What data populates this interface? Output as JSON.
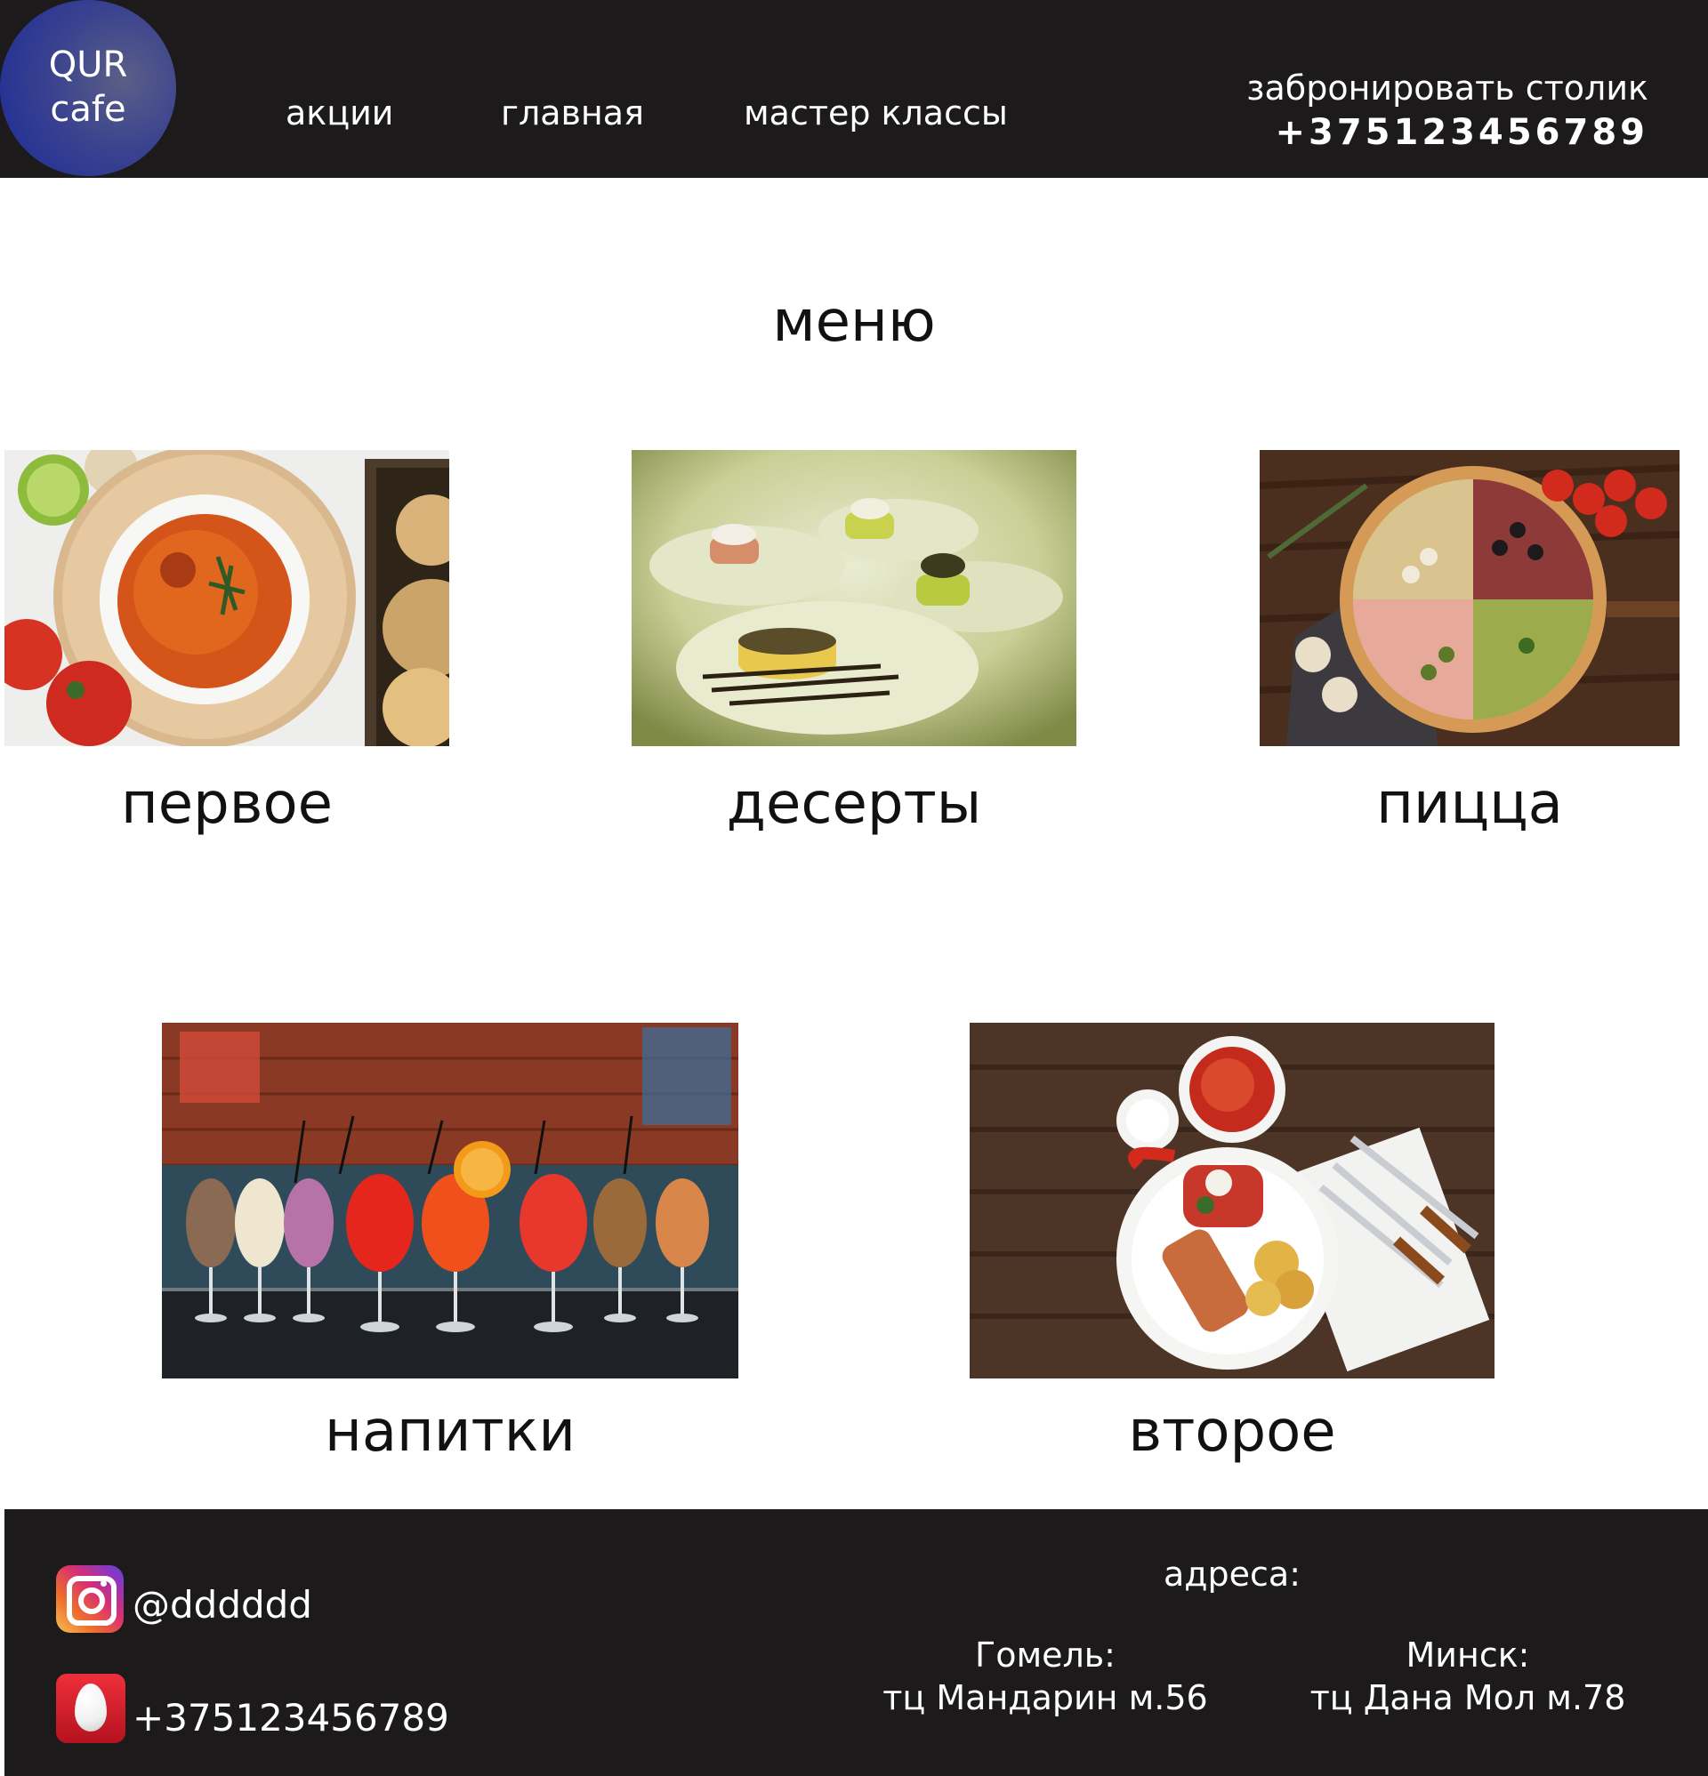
{
  "header": {
    "logo": {
      "line1": "QUR",
      "line2": "cafe"
    },
    "nav": [
      {
        "label": "акции"
      },
      {
        "label": "главная"
      },
      {
        "label": "мастер классы"
      }
    ],
    "booking": {
      "label": "забронировать столик",
      "phone": "+375123456789"
    }
  },
  "menu": {
    "title": "меню",
    "items": [
      {
        "label": "первое"
      },
      {
        "label": "десерты"
      },
      {
        "label": "пицца"
      },
      {
        "label": "напитки"
      },
      {
        "label": "второе"
      }
    ]
  },
  "footer": {
    "instagram": {
      "icon": "instagram-icon",
      "handle": "@dddddd"
    },
    "agent": {
      "icon": "mail-agent-icon",
      "phone": "+375123456789"
    },
    "addresses": {
      "title": "адреса:",
      "cities": [
        {
          "city": "Гомель:",
          "place": "тц Мандарин м.56"
        },
        {
          "city": "Минск:",
          "place": "тц Дана Мол м.78"
        }
      ]
    }
  },
  "colors": {
    "header_bg": "#1c1a1b",
    "footer_bg": "#1c1a1b",
    "text_light": "#ffffff",
    "text_dark": "#111111",
    "logo_gradient": [
      "#1a2a96",
      "#5a5f86"
    ]
  }
}
